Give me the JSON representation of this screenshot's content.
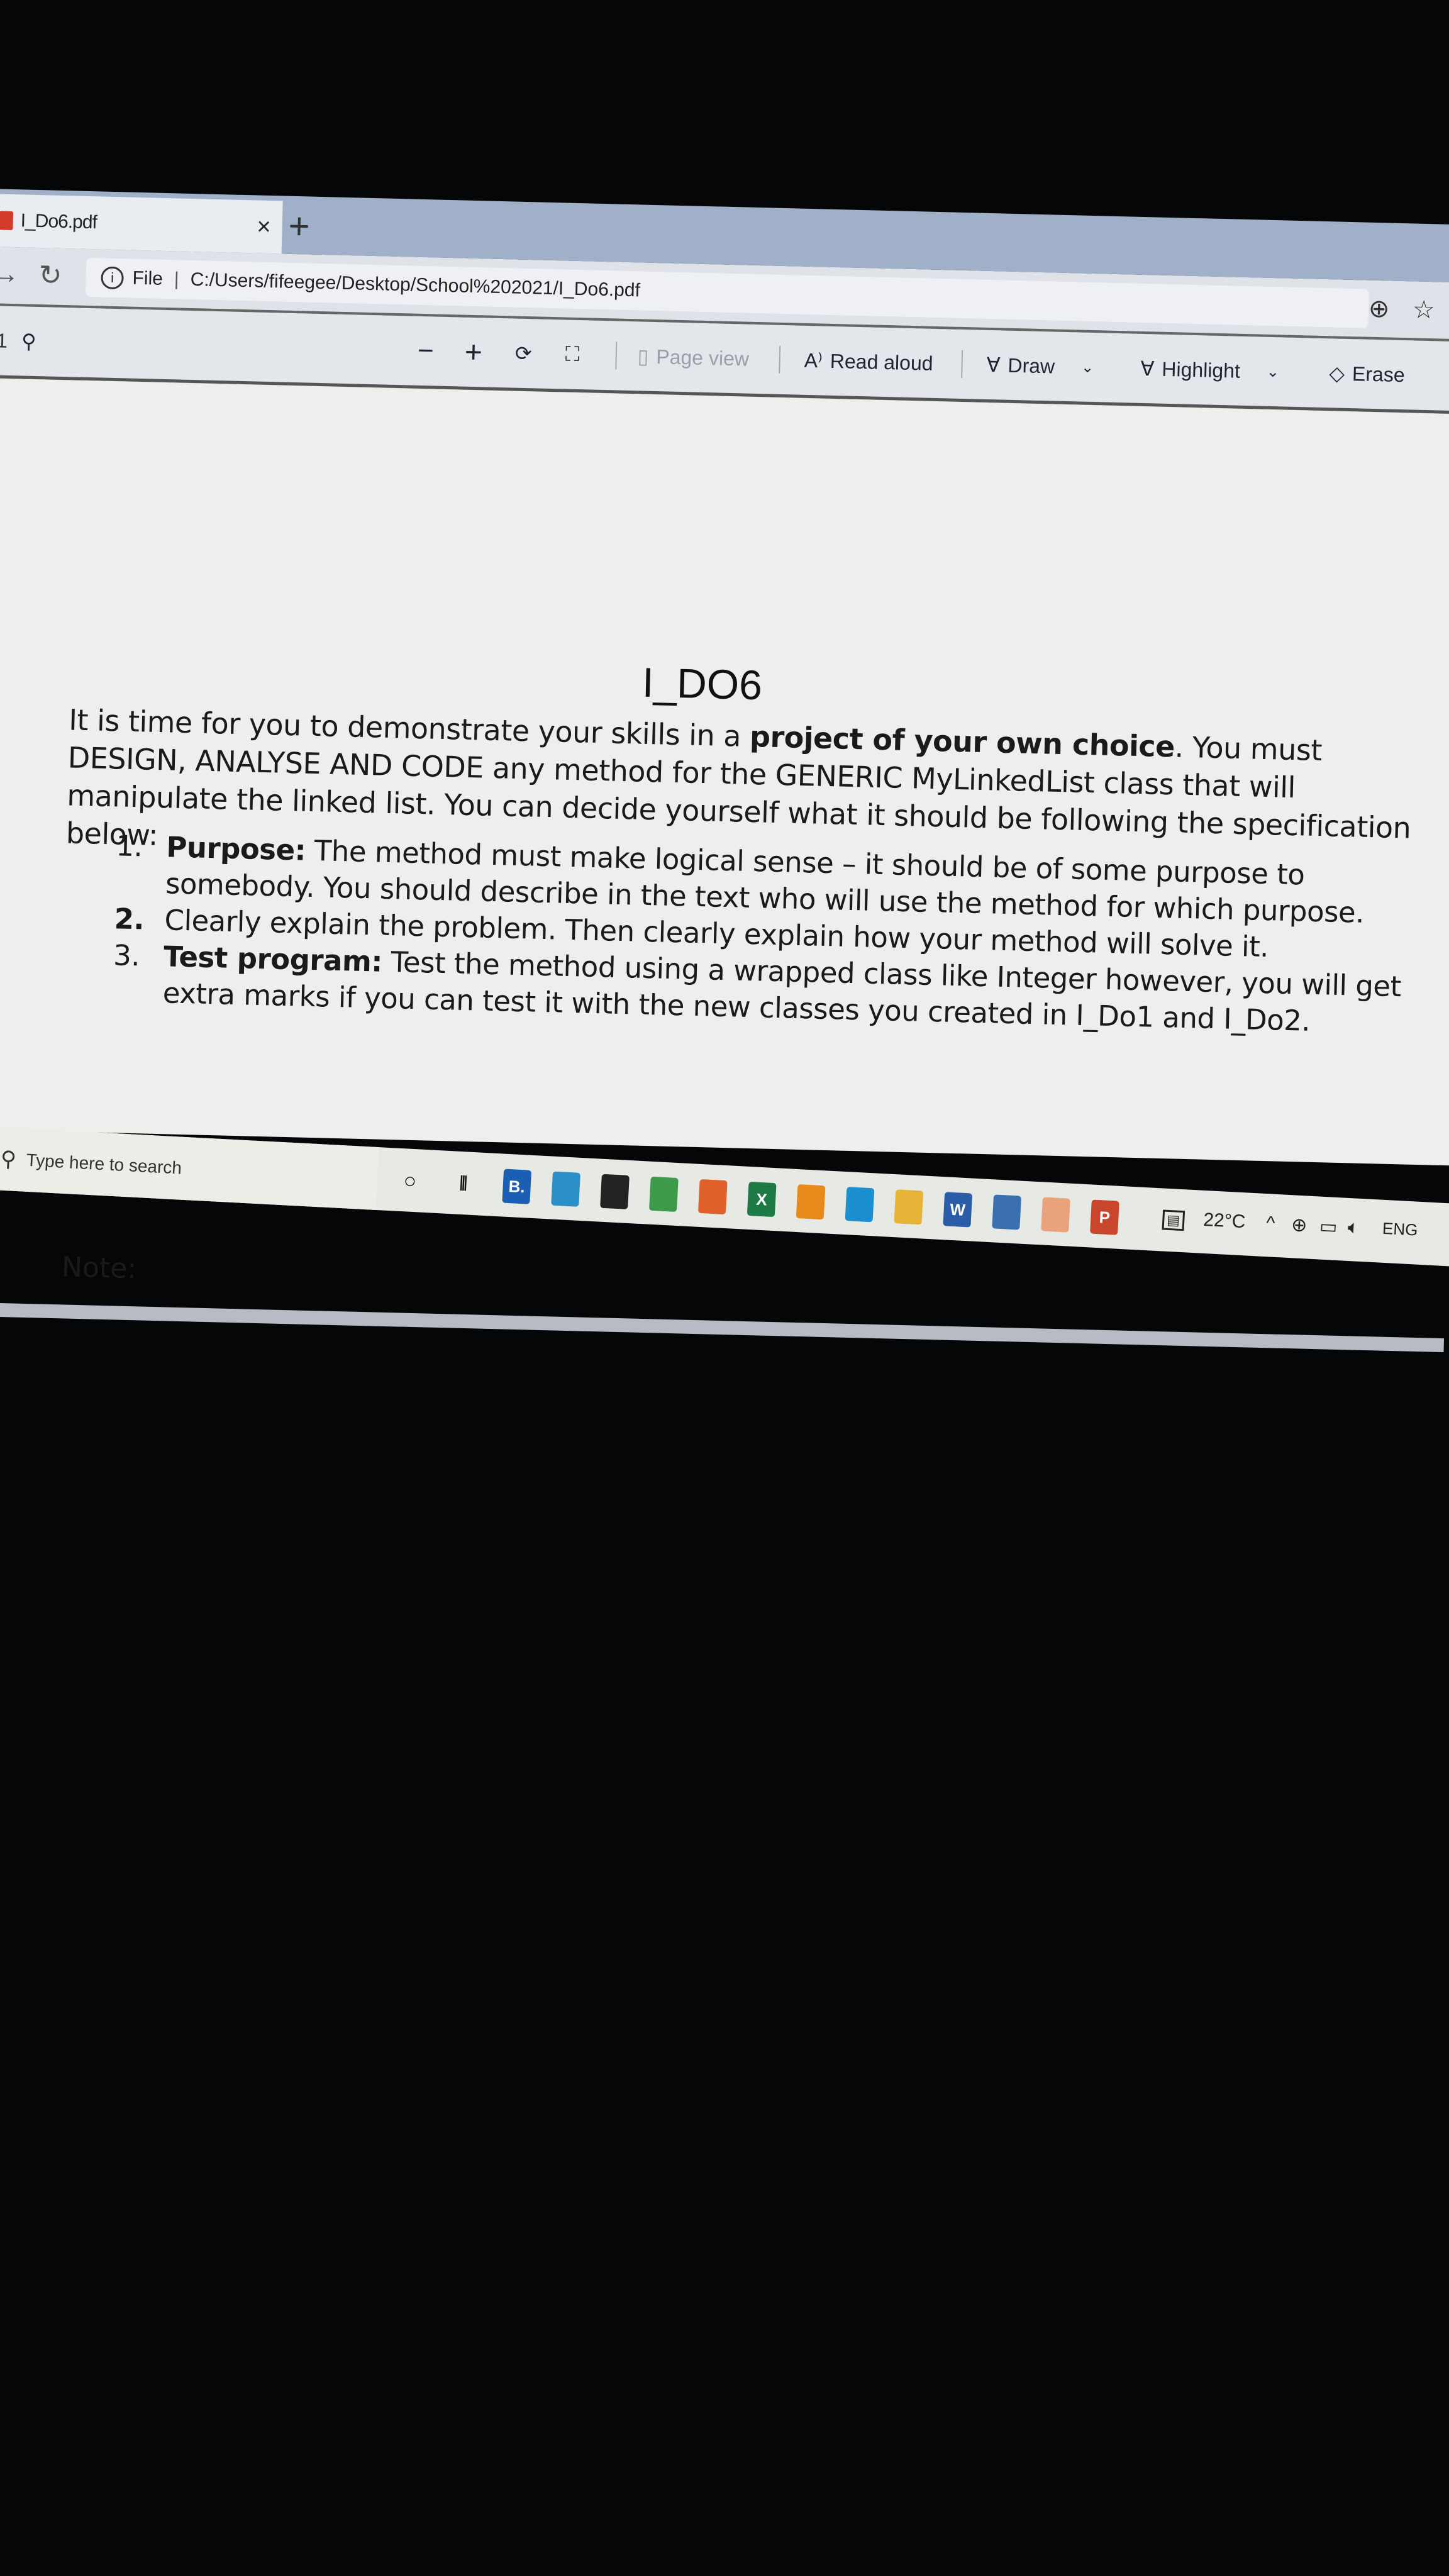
{
  "browser": {
    "tab_title": "I_Do6.pdf",
    "url_scheme_label": "File",
    "url": "C:/Users/fifeegee/Desktop/School%202021/I_Do6.pdf"
  },
  "pdf_toolbar": {
    "page_number": "1",
    "zoom_out": "−",
    "zoom_in": "+",
    "page_view": "Page view",
    "read_aloud": "Read aloud",
    "draw": "Draw",
    "highlight": "Highlight",
    "erase": "Erase"
  },
  "document": {
    "title": "I_DO6",
    "intro_1": "It is time for you to demonstrate your skills in a ",
    "intro_bold": "project of your own choice",
    "intro_2": ". You must DESIGN, ANALYSE AND CODE any method for the GENERIC MyLinkedList class that will manipulate the linked list. You can decide yourself what it should be following the specification below:",
    "items": [
      {
        "num": "1.",
        "bold": "Purpose:",
        "text": " The method must make logical sense – it should be of some purpose to somebody. You should describe in the text who will use the method for which purpose."
      },
      {
        "num": "2.",
        "bold": "",
        "text": "Clearly explain the problem. Then clearly explain how your method will solve it."
      },
      {
        "num": "3.",
        "bold": "Test program:",
        "text": " Test the method using a wrapped class like Integer however, you will get extra marks if you can test it with the new classes you created in I_Do1 and I_Do2."
      }
    ],
    "note": "Note:"
  },
  "taskbar": {
    "search_placeholder": "Type here to search",
    "apps": [
      {
        "name": "booking",
        "label": "B.",
        "color": "#1a5fb4"
      },
      {
        "name": "mail",
        "label": "",
        "color": "#2a8fc7"
      },
      {
        "name": "store",
        "label": "",
        "color": "#222222"
      },
      {
        "name": "chrome",
        "label": "",
        "color": "#3c9a4a"
      },
      {
        "name": "firefox",
        "label": "",
        "color": "#e0612a"
      },
      {
        "name": "excel",
        "label": "X",
        "color": "#1d7a45"
      },
      {
        "name": "vlc",
        "label": "",
        "color": "#e8891c"
      },
      {
        "name": "edge",
        "label": "",
        "color": "#1b8fd0"
      },
      {
        "name": "file-explorer",
        "label": "",
        "color": "#e7b43a"
      },
      {
        "name": "word",
        "label": "W",
        "color": "#2b5ca8"
      },
      {
        "name": "app-hexagon",
        "label": "",
        "color": "#3a6fb0"
      },
      {
        "name": "app-active",
        "label": "",
        "color": "#e9a27a"
      },
      {
        "name": "powerpoint",
        "label": "P",
        "color": "#c9452c"
      }
    ],
    "weather": "22°C",
    "language": "ENG"
  }
}
